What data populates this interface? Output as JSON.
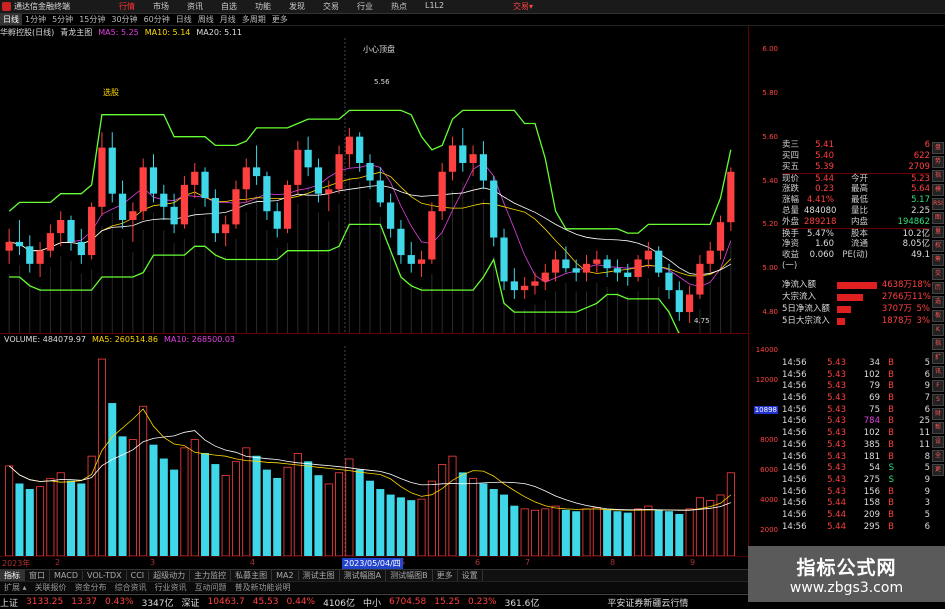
{
  "titlebar": {
    "app_title": "通达信金融终端",
    "menus": [
      "行情",
      "市场",
      "资讯",
      "自选",
      "功能",
      "发现",
      "交易",
      "行业",
      "热点",
      "L1L2"
    ],
    "active_menu": "行情",
    "right_label": "交易▾"
  },
  "periods": [
    "日线",
    "1分钟",
    "5分钟",
    "15分钟",
    "30分钟",
    "60分钟",
    "日线",
    "周线",
    "月线",
    "多周期",
    "更多"
  ],
  "active_period": "日线",
  "indicator_line": {
    "stock": "华孵控股(日线)",
    "indicator": "青龙主图",
    "ma5": "MA5: 5.25",
    "ma10": "MA10: 5.14",
    "ma20": "MA20: 5.11"
  },
  "annotations": {
    "top": "小心顶盘",
    "left": "选股",
    "peak": "5.56",
    "low": "4.75"
  },
  "volume_header": {
    "label": "VOLUME: 484079.97",
    "ma5": "MA5: 260514.86",
    "ma10": "MA10: 268500.03"
  },
  "date_axis": {
    "labels": [
      "2023年",
      "2",
      "3",
      "4",
      "5",
      "6",
      "7",
      "8",
      "9"
    ],
    "selected": "2023/05/04/四"
  },
  "price_axis": [
    "6.00",
    "5.80",
    "5.60",
    "5.40",
    "5.20",
    "5.00",
    "4.80"
  ],
  "vol_axis": [
    "14000",
    "12000",
    "10898",
    "8000",
    "6000",
    "4000",
    "2000"
  ],
  "vol_axis_highlight": "10898",
  "tabs": [
    "指标",
    "窗口",
    "MACD",
    "VOL-TDX",
    "CCI",
    "超级动力",
    "主力监控",
    "私募主图",
    "MA2",
    "测试主图",
    "测试幅图A",
    "测试幅图B",
    "更多",
    "设置"
  ],
  "tabs2": [
    "扩展 ▴",
    "关联报价",
    "资金分布",
    "综合资讯",
    "行业资讯",
    "互动问题",
    "普及新功能说明"
  ],
  "ticker": {
    "sh_label": "上证",
    "sh_value": "3133.25",
    "sh_change": "13.37",
    "sh_pct": "0.43%",
    "sh_amount": "3347亿",
    "sz_label": "深证",
    "sz_value": "10463.7",
    "sz_change": "45.53",
    "sz_pct": "0.44%",
    "sz_amount": "4106亿",
    "zx_label": "中小",
    "zx_value": "6704.58",
    "zx_change": "15.25",
    "zx_pct": "0.23%",
    "zx_amount": "361.6亿",
    "broker": "平安证券新疆云行情"
  },
  "quote": [
    {
      "k": "卖三",
      "v": "5.41",
      "k2": "",
      "v2": "6"
    },
    {
      "k": "买四",
      "v": "5.40",
      "k2": "",
      "v2": "622"
    },
    {
      "k": "买五",
      "v": "5.39",
      "k2": "",
      "v2": "2709"
    },
    {
      "k": "现价",
      "v": "5.44",
      "k2": "今开",
      "v2": "5.23"
    },
    {
      "k": "涨跌",
      "v": "0.23",
      "k2": "最高",
      "v2": "5.64"
    },
    {
      "k": "涨幅",
      "v": "4.41%",
      "k2": "最低",
      "v2": "5.17"
    },
    {
      "k": "总量",
      "v": "484080",
      "k2": "量比",
      "v2": "2.25"
    },
    {
      "k": "外盘",
      "v": "289218",
      "k2": "内盘",
      "v2": "194862"
    },
    {
      "k": "换手",
      "v": "5.47%",
      "k2": "股本",
      "v2": "10.2亿"
    },
    {
      "k": "净资",
      "v": "1.60",
      "k2": "流通",
      "v2": "8.05亿"
    },
    {
      "k": "收益(一)",
      "v": "0.060",
      "k2": "PE(动)",
      "v2": "49.1"
    }
  ],
  "flow": [
    {
      "k": "净流入额",
      "v": "4638万",
      "p": "18%",
      "w": 40
    },
    {
      "k": "大宗流入",
      "v": "2766万",
      "p": "11%",
      "w": 26
    },
    {
      "k": "5日净流入额",
      "v": "3707万",
      "p": "5%",
      "w": 14
    },
    {
      "k": "5日大宗流入",
      "v": "1878万",
      "p": "3%",
      "w": 8
    }
  ],
  "trades": [
    {
      "t": "14:56",
      "p": "5.43",
      "q": "34",
      "bs": "B",
      "n": "5"
    },
    {
      "t": "14:56",
      "p": "5.43",
      "q": "102",
      "bs": "B",
      "n": "6"
    },
    {
      "t": "14:56",
      "p": "5.43",
      "q": "79",
      "bs": "B",
      "n": "9"
    },
    {
      "t": "14:56",
      "p": "5.43",
      "q": "69",
      "bs": "B",
      "n": "7"
    },
    {
      "t": "14:56",
      "p": "5.43",
      "q": "75",
      "bs": "B",
      "n": "6"
    },
    {
      "t": "14:56",
      "p": "5.43",
      "q": "784",
      "bs": "B",
      "n": "25"
    },
    {
      "t": "14:56",
      "p": "5.43",
      "q": "102",
      "bs": "B",
      "n": "11"
    },
    {
      "t": "14:56",
      "p": "5.43",
      "q": "385",
      "bs": "B",
      "n": "11"
    },
    {
      "t": "14:56",
      "p": "5.43",
      "q": "181",
      "bs": "B",
      "n": "8"
    },
    {
      "t": "14:56",
      "p": "5.43",
      "q": "54",
      "bs": "S",
      "n": "5"
    },
    {
      "t": "14:56",
      "p": "5.43",
      "q": "275",
      "bs": "S",
      "n": "9"
    },
    {
      "t": "14:56",
      "p": "5.43",
      "q": "156",
      "bs": "B",
      "n": "9"
    },
    {
      "t": "14:56",
      "p": "5.44",
      "q": "158",
      "bs": "B",
      "n": "3"
    },
    {
      "t": "14:56",
      "p": "5.44",
      "q": "209",
      "bs": "B",
      "n": "5"
    },
    {
      "t": "14:56",
      "p": "5.44",
      "q": "295",
      "bs": "B",
      "n": "6"
    }
  ],
  "sidebar": [
    "盘",
    "势",
    "指",
    "模",
    "RSI",
    "图",
    "量",
    "权",
    "筹",
    "交",
    "历",
    "选",
    "板",
    "K",
    "指",
    "扩",
    "讯",
    "F",
    "S",
    "财",
    "帮",
    "设",
    "全",
    "更"
  ],
  "watermark": {
    "line1": "指标公式网",
    "line2": "www.zbgs3.com"
  },
  "bottom_right": "图文F10",
  "colors": {
    "up": "#ff4040",
    "down": "#40d8e8",
    "band": "#66ff33",
    "ma5": "#ffffff",
    "ma10": "#ffd800",
    "ma20": "#e040e0"
  },
  "chart_data": {
    "type": "candlestick",
    "ylim": [
      4.7,
      6.05
    ],
    "ohlc": [
      [
        5.08,
        5.18,
        5.02,
        5.12
      ],
      [
        5.12,
        5.22,
        5.06,
        5.1
      ],
      [
        5.1,
        5.15,
        4.98,
        5.02
      ],
      [
        5.02,
        5.12,
        4.96,
        5.08
      ],
      [
        5.08,
        5.2,
        5.05,
        5.16
      ],
      [
        5.16,
        5.26,
        5.1,
        5.22
      ],
      [
        5.22,
        5.24,
        5.08,
        5.12
      ],
      [
        5.12,
        5.18,
        5.02,
        5.06
      ],
      [
        5.06,
        5.3,
        5.04,
        5.28
      ],
      [
        5.28,
        5.62,
        5.24,
        5.55
      ],
      [
        5.55,
        5.62,
        5.3,
        5.34
      ],
      [
        5.34,
        5.4,
        5.18,
        5.22
      ],
      [
        5.22,
        5.3,
        5.12,
        5.26
      ],
      [
        5.26,
        5.5,
        5.22,
        5.46
      ],
      [
        5.46,
        5.52,
        5.3,
        5.34
      ],
      [
        5.34,
        5.38,
        5.22,
        5.28
      ],
      [
        5.28,
        5.34,
        5.16,
        5.2
      ],
      [
        5.2,
        5.42,
        5.18,
        5.38
      ],
      [
        5.38,
        5.48,
        5.32,
        5.44
      ],
      [
        5.44,
        5.46,
        5.28,
        5.32
      ],
      [
        5.32,
        5.36,
        5.12,
        5.16
      ],
      [
        5.16,
        5.24,
        5.1,
        5.2
      ],
      [
        5.2,
        5.4,
        5.18,
        5.36
      ],
      [
        5.36,
        5.5,
        5.3,
        5.46
      ],
      [
        5.46,
        5.56,
        5.38,
        5.42
      ],
      [
        5.42,
        5.44,
        5.22,
        5.26
      ],
      [
        5.26,
        5.3,
        5.14,
        5.18
      ],
      [
        5.18,
        5.4,
        5.16,
        5.38
      ],
      [
        5.38,
        5.58,
        5.34,
        5.54
      ],
      [
        5.54,
        5.6,
        5.42,
        5.46
      ],
      [
        5.46,
        5.5,
        5.3,
        5.34
      ],
      [
        5.34,
        5.4,
        5.26,
        5.36
      ],
      [
        5.36,
        5.56,
        5.34,
        5.52
      ],
      [
        5.52,
        5.64,
        5.46,
        5.6
      ],
      [
        5.6,
        5.62,
        5.44,
        5.48
      ],
      [
        5.48,
        5.52,
        5.36,
        5.4
      ],
      [
        5.4,
        5.46,
        5.28,
        5.3
      ],
      [
        5.3,
        5.34,
        5.14,
        5.18
      ],
      [
        5.18,
        5.22,
        5.02,
        5.06
      ],
      [
        5.06,
        5.12,
        4.98,
        5.02
      ],
      [
        5.02,
        5.08,
        4.96,
        5.04
      ],
      [
        5.04,
        5.3,
        5.02,
        5.26
      ],
      [
        5.26,
        5.48,
        5.22,
        5.44
      ],
      [
        5.44,
        5.6,
        5.4,
        5.56
      ],
      [
        5.56,
        5.64,
        5.44,
        5.48
      ],
      [
        5.48,
        5.56,
        5.42,
        5.52
      ],
      [
        5.52,
        5.58,
        5.36,
        5.4
      ],
      [
        5.4,
        5.42,
        5.1,
        5.14
      ],
      [
        5.14,
        5.18,
        4.9,
        4.94
      ],
      [
        4.94,
        5.0,
        4.86,
        4.9
      ],
      [
        4.9,
        4.96,
        4.86,
        4.92
      ],
      [
        4.92,
        4.98,
        4.88,
        4.94
      ],
      [
        4.94,
        5.02,
        4.9,
        4.98
      ],
      [
        4.98,
        5.08,
        4.94,
        5.04
      ],
      [
        5.04,
        5.1,
        4.98,
        5.0
      ],
      [
        5.0,
        5.04,
        4.94,
        4.98
      ],
      [
        4.98,
        5.06,
        4.94,
        5.02
      ],
      [
        5.02,
        5.08,
        4.98,
        5.04
      ],
      [
        5.04,
        5.06,
        4.96,
        5.0
      ],
      [
        5.0,
        5.04,
        4.94,
        4.98
      ],
      [
        4.98,
        5.02,
        4.92,
        4.96
      ],
      [
        4.96,
        5.06,
        4.94,
        5.04
      ],
      [
        5.04,
        5.12,
        5.0,
        5.08
      ],
      [
        5.08,
        5.1,
        4.96,
        4.98
      ],
      [
        4.98,
        5.02,
        4.86,
        4.9
      ],
      [
        4.9,
        4.94,
        4.76,
        4.8
      ],
      [
        4.8,
        4.92,
        4.75,
        4.88
      ],
      [
        4.88,
        5.06,
        4.86,
        5.02
      ],
      [
        5.02,
        5.12,
        4.98,
        5.08
      ],
      [
        5.08,
        5.24,
        5.04,
        5.21
      ],
      [
        5.21,
        5.46,
        5.17,
        5.44
      ]
    ],
    "volume": [
      6500,
      5200,
      4800,
      5000,
      5600,
      6000,
      5400,
      5200,
      7200,
      14200,
      11000,
      8600,
      8400,
      10800,
      8000,
      7000,
      6200,
      7800,
      8400,
      7400,
      6600,
      5800,
      6800,
      7800,
      7200,
      6200,
      5600,
      6400,
      7400,
      6800,
      5800,
      5200,
      6000,
      7000,
      6200,
      5400,
      4800,
      4400,
      4200,
      4000,
      4100,
      5400,
      6600,
      7200,
      6000,
      5600,
      5200,
      4800,
      4400,
      3600,
      3400,
      3300,
      3400,
      3600,
      3300,
      3200,
      3400,
      3500,
      3300,
      3200,
      3100,
      3400,
      3600,
      3300,
      3200,
      3000,
      3400,
      4200,
      4000,
      4400,
      6000
    ]
  }
}
